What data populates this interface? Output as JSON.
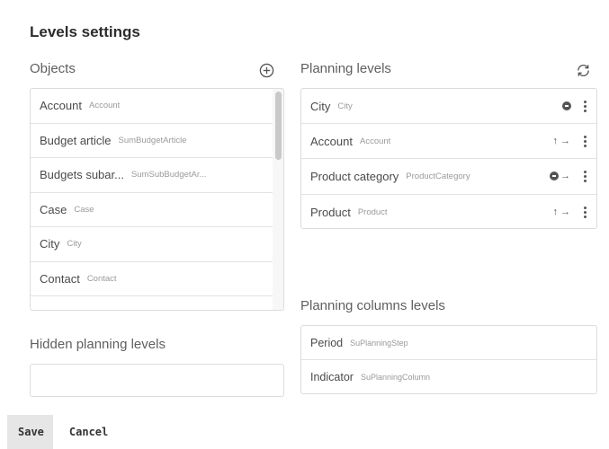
{
  "page": {
    "title": "Levels settings"
  },
  "objects": {
    "title": "Objects",
    "items": [
      {
        "name": "Account",
        "code": "Account"
      },
      {
        "name": "Budget article",
        "code": "SumBudgetArticle"
      },
      {
        "name": "Budgets subar...",
        "code": "SumSubBudgetAr..."
      },
      {
        "name": "Case",
        "code": "Case"
      },
      {
        "name": "City",
        "code": "City"
      },
      {
        "name": "Contact",
        "code": "Contact"
      }
    ]
  },
  "planning_levels": {
    "title": "Planning levels",
    "items": [
      {
        "name": "City",
        "code": "City"
      },
      {
        "name": "Account",
        "code": "Account"
      },
      {
        "name": "Product category",
        "code": "ProductCategory"
      },
      {
        "name": "Product",
        "code": "Product"
      }
    ]
  },
  "hidden_planning_levels": {
    "title": "Hidden planning levels"
  },
  "planning_columns_levels": {
    "title": "Planning columns levels",
    "items": [
      {
        "name": "Period",
        "code": "SuPlanningStep"
      },
      {
        "name": "Indicator",
        "code": "SuPlanningColumn"
      }
    ]
  },
  "footer": {
    "save_label": "Save",
    "cancel_label": "Cancel"
  },
  "icons": {
    "add": "add-circle-icon",
    "refresh": "refresh-icon",
    "level_dot": "level-dot-icon",
    "arrows": "arrow-icons",
    "menu": "kebab-menu-icon"
  }
}
